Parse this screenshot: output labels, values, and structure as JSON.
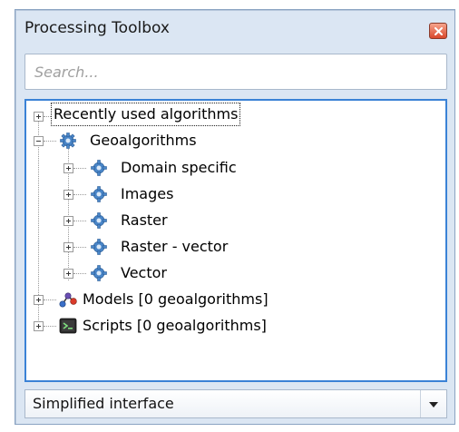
{
  "window": {
    "title": "Processing Toolbox"
  },
  "search": {
    "placeholder": "Search..."
  },
  "tree": {
    "recent": {
      "label": "Recently used algorithms"
    },
    "geoalgorithms": {
      "label": "Geoalgorithms",
      "children": [
        {
          "label": "Domain specific",
          "icon": "gear-icon"
        },
        {
          "label": "Images",
          "icon": "gear-icon"
        },
        {
          "label": "Raster",
          "icon": "gear-icon"
        },
        {
          "label": "Raster - vector",
          "icon": "gear-icon"
        },
        {
          "label": "Vector",
          "icon": "gear-icon"
        }
      ]
    },
    "models": {
      "label": "Models [0 geoalgorithms]",
      "icon": "models-icon"
    },
    "scripts": {
      "label": "Scripts [0 geoalgorithms]",
      "icon": "terminal-icon"
    }
  },
  "footer": {
    "mode_selected": "Simplified interface"
  },
  "colors": {
    "panel_bg": "#dbe6f3",
    "tree_border": "#3a82d6",
    "close_button": "#d9482c",
    "gear": "#4a86c8"
  }
}
